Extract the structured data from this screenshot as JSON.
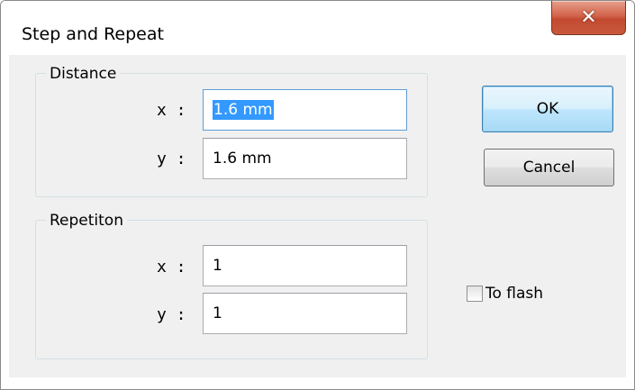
{
  "window": {
    "title": "Step and Repeat",
    "close_icon": "close-icon",
    "close_glyph": "✕"
  },
  "distance": {
    "group_label": "Distance",
    "x_label": "x :",
    "x_value": "1.6 mm",
    "y_label": "y :",
    "y_value": "1.6 mm"
  },
  "repetition": {
    "group_label": "Repetiton",
    "x_label": "x :",
    "x_value": "1",
    "y_label": "y :",
    "y_value": "1"
  },
  "buttons": {
    "ok_label": "OK",
    "cancel_label": "Cancel"
  },
  "options": {
    "to_flash_label": "To flash",
    "to_flash_checked": false
  },
  "colors": {
    "selection": "#3399ff",
    "close_button": "#c9583b",
    "default_button": "#bee6fd",
    "dialog_background": "#f0f0f0"
  }
}
